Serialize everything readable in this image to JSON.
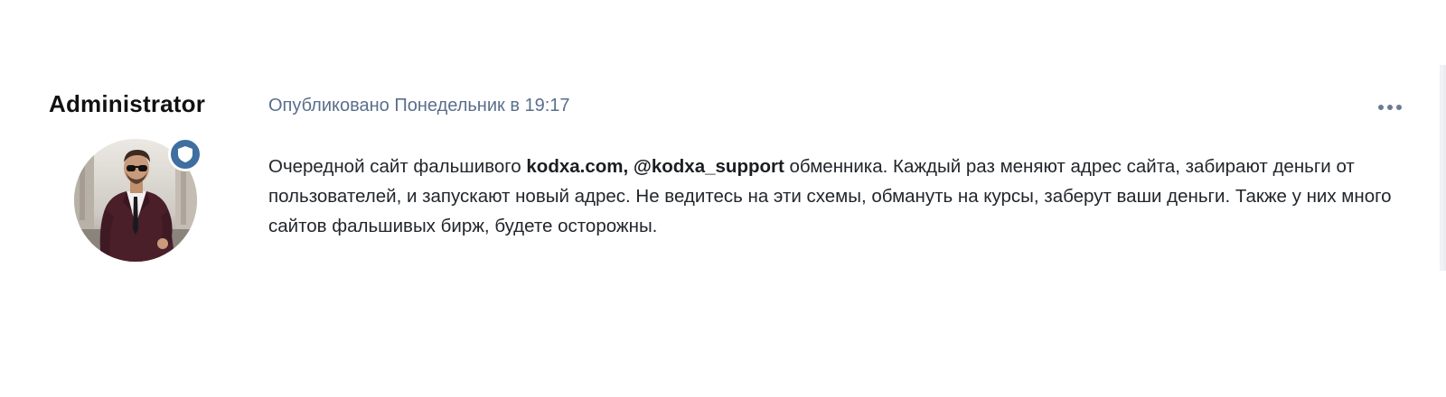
{
  "post": {
    "author": {
      "name": "Administrator",
      "avatar_icon": "user-photo",
      "badge_icon": "shield-icon",
      "badge_color": "#3f6ea0"
    },
    "meta": "Опубликовано Понедельник в 19:17",
    "more_icon": "ellipsis-icon",
    "body": {
      "text_1": "Очередной сайт фальшивого ",
      "bold": "kodxa.com, @kodxa_support",
      "text_2": " обменника. Каждый раз меняют адрес сайта, забирают деньги от пользователей, и запускают новый адрес. Не ведитесь на эти схемы, обмануть на курсы, заберут ваши деньги. Также у них много сайтов фальшивых бирж, будете осторожны."
    }
  },
  "colors": {
    "meta_text": "#5b6f8c",
    "body_text": "#22262b",
    "accent": "#3f6ea0"
  }
}
